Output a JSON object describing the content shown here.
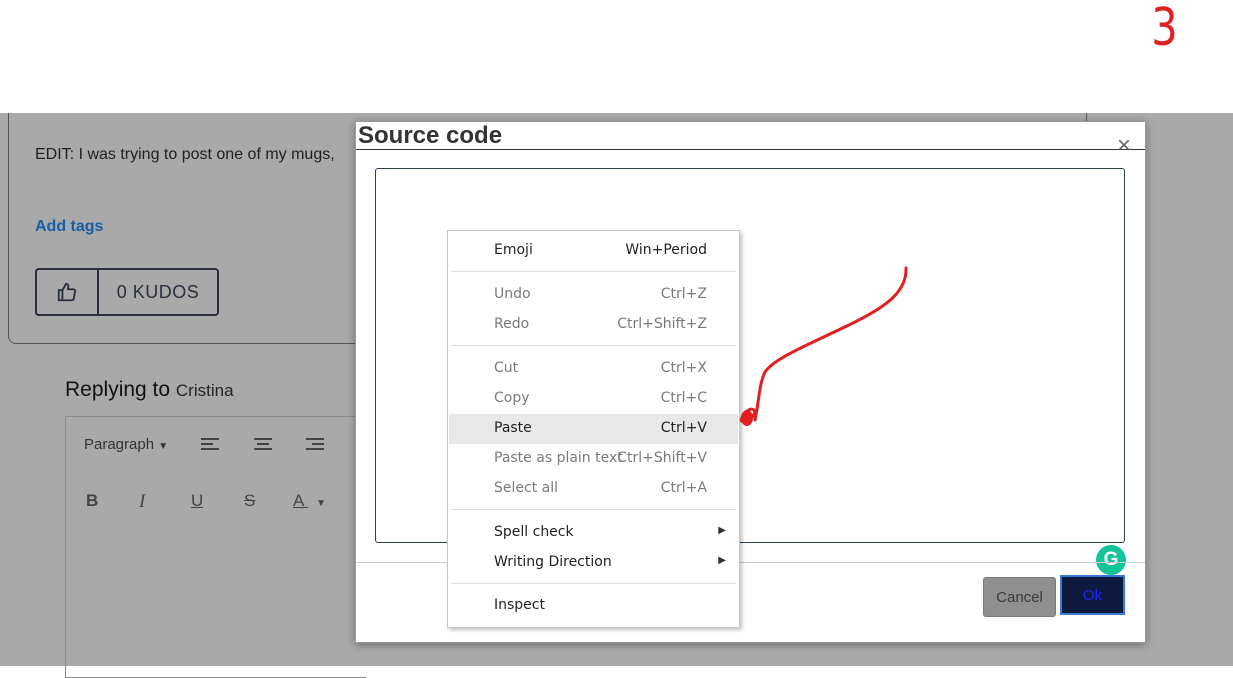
{
  "annotation": {
    "number": "3"
  },
  "post": {
    "text": "EDIT: I was trying to post one of my mugs,",
    "add_tags": "Add tags",
    "kudos_label": "0 KUDOS"
  },
  "reply": {
    "prefix": "Replying to",
    "name": "Cristina"
  },
  "toolbar": {
    "paragraph": "Paragraph",
    "bold": "B",
    "italic": "I",
    "underline": "U",
    "strike": "S",
    "font_color": "A"
  },
  "modal": {
    "title": "Source code",
    "close": "×",
    "cancel_label": "Cancel",
    "ok_label": "Ok"
  },
  "context_menu": {
    "items": [
      {
        "label": "Emoji",
        "shortcut": "Win+Period"
      },
      {
        "label": "Undo",
        "shortcut": "Ctrl+Z"
      },
      {
        "label": "Redo",
        "shortcut": "Ctrl+Shift+Z"
      },
      {
        "label": "Cut",
        "shortcut": "Ctrl+X"
      },
      {
        "label": "Copy",
        "shortcut": "Ctrl+C"
      },
      {
        "label": "Paste",
        "shortcut": "Ctrl+V"
      },
      {
        "label": "Paste as plain text",
        "shortcut": "Ctrl+Shift+V"
      },
      {
        "label": "Select all",
        "shortcut": "Ctrl+A"
      },
      {
        "label": "Spell check",
        "shortcut": ""
      },
      {
        "label": "Writing Direction",
        "shortcut": ""
      },
      {
        "label": "Inspect",
        "shortcut": ""
      }
    ]
  },
  "colors": {
    "annotation_red": "#e02020",
    "highlight_yellow": "#f0f000",
    "grammarly_green": "#15c39a",
    "link_blue": "#1560a8"
  }
}
